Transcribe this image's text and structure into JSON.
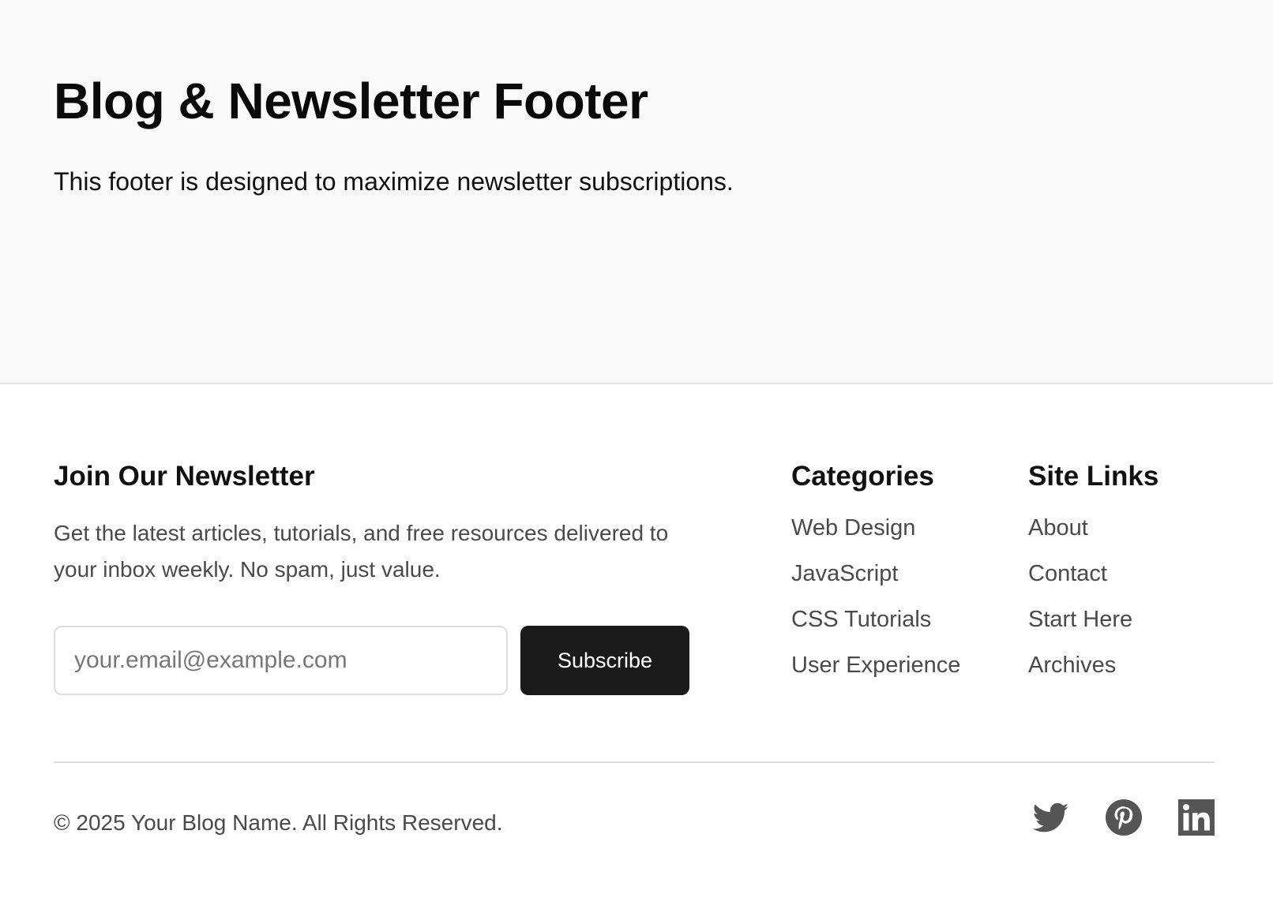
{
  "hero": {
    "title": "Blog & Newsletter Footer",
    "intro": "This footer is designed to maximize newsletter subscriptions."
  },
  "newsletter": {
    "heading": "Join Our Newsletter",
    "description": "Get the latest articles, tutorials, and free resources delivered to your inbox weekly. No spam, just value.",
    "email_placeholder": "your.email@example.com",
    "email_value": "",
    "button_label": "Subscribe"
  },
  "categories": {
    "heading": "Categories",
    "items": [
      "Web Design",
      "JavaScript",
      "CSS Tutorials",
      "User Experience"
    ]
  },
  "site_links": {
    "heading": "Site Links",
    "items": [
      "About",
      "Contact",
      "Start Here",
      "Archives"
    ]
  },
  "bottom": {
    "copyright": "© 2025 Your Blog Name. All Rights Reserved.",
    "social_icons": [
      "twitter-icon",
      "pinterest-icon",
      "linkedin-icon"
    ]
  },
  "colors": {
    "top_background": "#f9f9f9",
    "button_background": "#1a1a1a",
    "link_text": "#4a4a4a",
    "icon": "#555555"
  }
}
